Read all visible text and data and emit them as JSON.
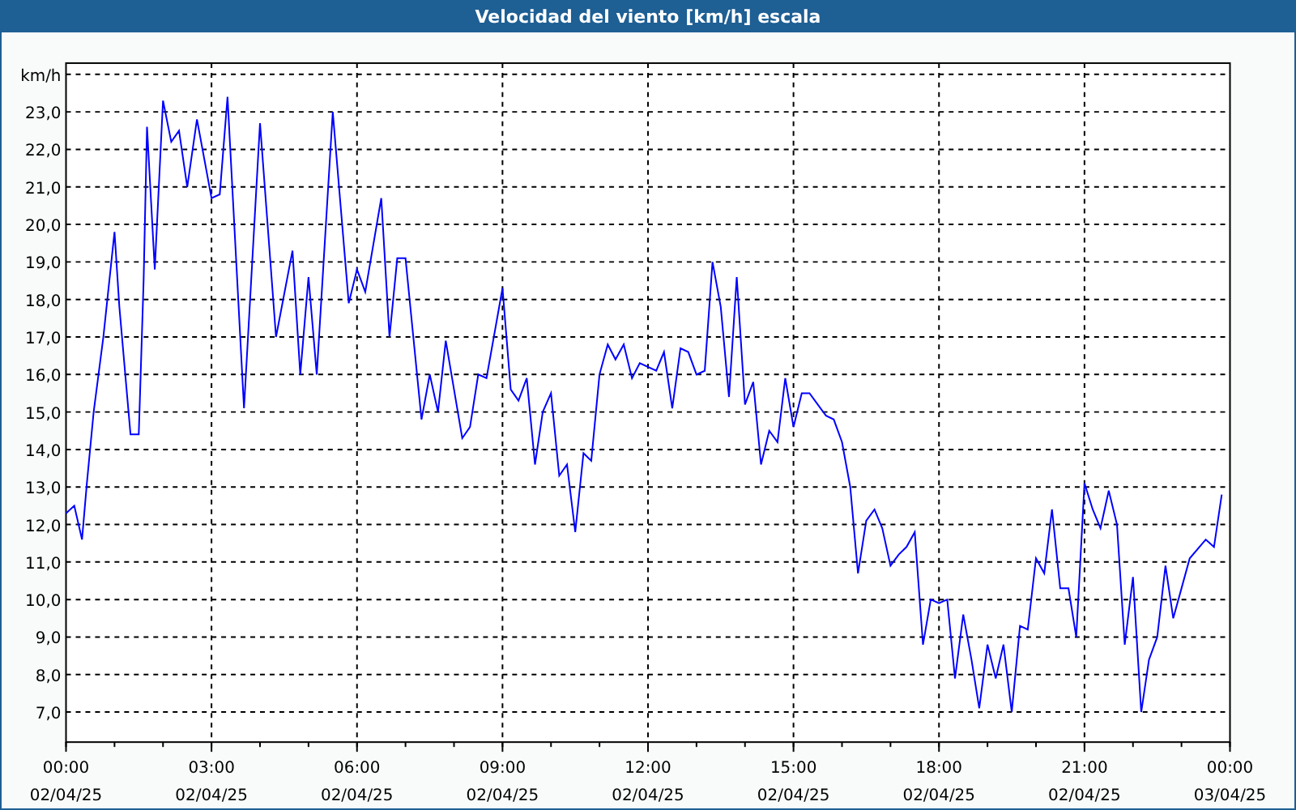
{
  "window": {
    "title": "Velocidad del viento [km/h] escala"
  },
  "chart": {
    "chart_data": {
      "type": "line",
      "grid": true,
      "ylabel": "km/h",
      "x": [
        0,
        0.17,
        0.33,
        0.43,
        0.57,
        0.77,
        1.0,
        1.1,
        1.33,
        1.5,
        1.6,
        1.67,
        1.83,
        2.0,
        2.17,
        2.33,
        2.5,
        2.7,
        3.0,
        3.17,
        3.33,
        3.67,
        4.0,
        4.33,
        4.67,
        4.83,
        5.0,
        5.17,
        5.5,
        5.83,
        6.0,
        6.17,
        6.5,
        6.67,
        6.83,
        7.0,
        7.33,
        7.5,
        7.67,
        7.83,
        8.17,
        8.33,
        8.5,
        8.67,
        9.0,
        9.17,
        9.33,
        9.5,
        9.67,
        9.83,
        10.0,
        10.17,
        10.33,
        10.5,
        10.67,
        10.83,
        11.0,
        11.17,
        11.33,
        11.5,
        11.67,
        11.83,
        12.17,
        12.33,
        12.5,
        12.67,
        12.83,
        13.0,
        13.17,
        13.33,
        13.5,
        13.67,
        13.83,
        14.0,
        14.17,
        14.33,
        14.5,
        14.67,
        14.83,
        15.0,
        15.17,
        15.33,
        15.5,
        15.67,
        15.83,
        16.0,
        16.17,
        16.33,
        16.5,
        16.67,
        16.83,
        17.0,
        17.17,
        17.33,
        17.5,
        17.67,
        17.83,
        18.0,
        18.17,
        18.33,
        18.5,
        18.67,
        18.83,
        19.0,
        19.17,
        19.33,
        19.5,
        19.67,
        19.83,
        20.0,
        20.17,
        20.33,
        20.5,
        20.67,
        20.83,
        21.0,
        21.17,
        21.33,
        21.5,
        21.67,
        21.83,
        22.0,
        22.17,
        22.33,
        22.5,
        22.67,
        22.83,
        23.0,
        23.17,
        23.5,
        23.67,
        23.83
      ],
      "series": [
        {
          "color": "#0000ff",
          "values": [
            12.3,
            12.5,
            11.6,
            13.1,
            15.0,
            17.0,
            19.8,
            17.8,
            14.4,
            14.4,
            18.5,
            22.6,
            18.8,
            23.3,
            22.2,
            22.5,
            21.0,
            22.8,
            20.7,
            20.8,
            23.4,
            15.1,
            22.7,
            17.0,
            19.3,
            16.0,
            18.6,
            16.0,
            23.0,
            17.9,
            18.8,
            18.2,
            20.7,
            17.0,
            19.1,
            19.1,
            14.8,
            16.0,
            15.0,
            16.9,
            14.3,
            14.6,
            16.0,
            15.9,
            18.3,
            15.6,
            15.3,
            15.9,
            13.6,
            15.0,
            15.5,
            13.3,
            13.6,
            11.8,
            13.9,
            13.7,
            16.0,
            16.8,
            16.4,
            16.8,
            15.9,
            16.3,
            16.1,
            16.6,
            15.1,
            16.7,
            16.6,
            16.0,
            16.1,
            19.0,
            17.8,
            15.4,
            18.6,
            15.2,
            15.8,
            13.6,
            14.5,
            14.2,
            15.9,
            14.6,
            15.5,
            15.5,
            15.2,
            14.9,
            14.8,
            14.2,
            13.0,
            10.7,
            12.1,
            12.4,
            11.9,
            10.9,
            11.2,
            11.4,
            11.8,
            8.8,
            10.0,
            9.9,
            10.0,
            7.9,
            9.6,
            8.4,
            7.1,
            8.8,
            7.9,
            8.8,
            7.0,
            9.3,
            9.2,
            11.1,
            10.7,
            12.4,
            10.3,
            10.3,
            9.0,
            13.1,
            12.4,
            11.9,
            12.9,
            12.0,
            8.8,
            10.6,
            7.0,
            8.4,
            9.0,
            10.9,
            9.5,
            10.3,
            11.1,
            11.6,
            11.4,
            12.8
          ]
        }
      ],
      "xlim": [
        0,
        24
      ],
      "ylim": [
        6.2,
        24.3
      ],
      "xticks": [
        {
          "value": 0,
          "label": "00:00"
        },
        {
          "value": 3,
          "label": "03:00"
        },
        {
          "value": 6,
          "label": "06:00"
        },
        {
          "value": 9,
          "label": "09:00"
        },
        {
          "value": 12,
          "label": "12:00"
        },
        {
          "value": 15,
          "label": "15:00"
        },
        {
          "value": 18,
          "label": "18:00"
        },
        {
          "value": 21,
          "label": "21:00"
        },
        {
          "value": 24,
          "label": "00:00"
        }
      ],
      "yticks": [
        {
          "value": 7,
          "label": "7,0"
        },
        {
          "value": 8,
          "label": "8,0"
        },
        {
          "value": 9,
          "label": "9,0"
        },
        {
          "value": 10,
          "label": "10,0"
        },
        {
          "value": 11,
          "label": "11,0"
        },
        {
          "value": 12,
          "label": "12,0"
        },
        {
          "value": 13,
          "label": "13,0"
        },
        {
          "value": 14,
          "label": "14,0"
        },
        {
          "value": 15,
          "label": "15,0"
        },
        {
          "value": 16,
          "label": "16,0"
        },
        {
          "value": 17,
          "label": "17,0"
        },
        {
          "value": 18,
          "label": "18,0"
        },
        {
          "value": 19,
          "label": "19,0"
        },
        {
          "value": 20,
          "label": "20,0"
        },
        {
          "value": 21,
          "label": "21,0"
        },
        {
          "value": 22,
          "label": "22,0"
        },
        {
          "value": 23,
          "label": "23,0"
        }
      ]
    },
    "x_dates": [
      "02/04/25",
      "02/04/25",
      "02/04/25",
      "02/04/25",
      "02/04/25",
      "02/04/25",
      "02/04/25",
      "02/04/25",
      "03/04/25"
    ]
  }
}
